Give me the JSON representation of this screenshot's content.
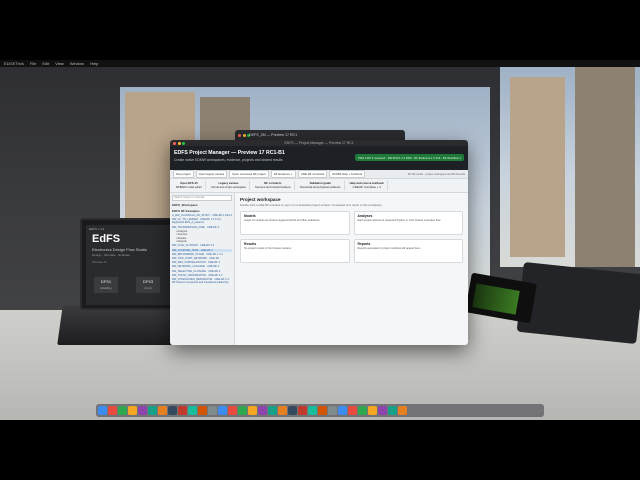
{
  "menubar": {
    "items": [
      "EDGETrick",
      "File",
      "Edit",
      "View",
      "Window",
      "Help"
    ]
  },
  "back_window": {
    "title": "DEFS_2M — Preview 17 RC1"
  },
  "window": {
    "titlebar_title": "EDFS — Project Manager — Preview 17 RC1",
    "header_title": "EDFS Project Manager — Preview 17 RC1-B1",
    "header_subtitle": "Create native EDMW workspaces, evidence, projects and shared results",
    "header_badge": "PRE 4 RF 9 reviewed · DW RCF1 2 4 RRS · RF Evidence 1 0 Full · RF Workflow 1",
    "toolbar": {
      "buttons": [
        "New project",
        "Open legacy canvas",
        "Open recovered RF project",
        "RF Evidence ✓",
        "CRE-RF Contracts",
        "RCMW Help + Textbook"
      ],
      "status": "RF 99 results · project workspace and RF Results"
    },
    "ribbon": [
      {
        "title": "Open EFS-15",
        "sub": "RFBAM model editor"
      },
      {
        "title": "Legacy canvas",
        "sub": "Circuit and script workspace"
      },
      {
        "title": "RF contracts",
        "sub": "Sources and transformations"
      },
      {
        "title": "Validation guide",
        "sub": "Numerical and physical evidence"
      },
      {
        "title": "Help and course textbook",
        "sub": "CRE-RF Complete + 4"
      }
    ],
    "sidebar": {
      "search_placeholder": "Search project or example",
      "groups": [
        {
          "label": "EDFS_Workspace",
          "items": []
        },
        {
          "label": "EDFS RF Examples",
          "items": [
            "A_RW_CLASSICAL_PA_STUDY · CRE-RF 1 Part 2",
            "RW_LC_TN_LADDER · CRE-RF 1 4 4 C4 · Supported EOS_d_patterns",
            "RW_TRANSMISSION_LINE · CRE-RF 3",
            "RW_LCAV_AUTOTAP · CRE-RF 3 5",
            "RW_COUPLED_TANK · CRE-RF 3",
            "RW_BROADBAND_PLANE · CRE-RF 1 4 4",
            "RW_TWO_PORT_NETWORK · CRE-RF",
            "RW_RES_NORMALIZATION · CRE-RF 3",
            "RW_NETWORK_CASCADE · CRE-RF 4",
            "RW_SELECTIVE_CLOSURE · CRE-RF 4",
            "RW_STATIC_INFORMATION · CRE-RF 3 4",
            "RW_ATTENUATED_RESONATOR · CRE-RF 2 4 · RF channel compound and impedance balancing"
          ]
        }
      ],
      "selected_index": 4,
      "subitems": [
        "Analysis",
        "Sources",
        "Results",
        "Reports"
      ]
    },
    "main": {
      "title": "Project workspace",
      "subtitle": "Double-click a CRE-RF example to open it in a dedicated project window. Completed runs return to this workspace.",
      "cards": [
        {
          "title": "Models",
          "desc": "Graph v3 models use shared registered block and fiber definitions."
        },
        {
          "title": "Analyses",
          "desc": "Each project selects its requested Python or Octo Octave execution flow."
        },
        {
          "title": "Results",
          "desc": "No project results in this browser session."
        },
        {
          "title": "Reports",
          "desc": "Reports generated in project windows will appear here."
        }
      ]
    }
  },
  "laptop": {
    "header": "EDFS v.4.3",
    "app_name": "EdFS",
    "tagline": "Electronics Design Flow Studio",
    "sub": "Design · Simulate · Evaluate",
    "version": "Preview 17",
    "tile1": "DFS1",
    "tile1_label": "Modelling",
    "tile2": "DFS3",
    "tile2_label": "Circuit"
  },
  "dock": {
    "icons": [
      "finder",
      "launchpad",
      "safari",
      "messages",
      "mail",
      "maps",
      "photos",
      "facetime",
      "calendar",
      "contacts",
      "reminders",
      "notes",
      "music",
      "podcasts",
      "tv",
      "news",
      "app-store",
      "settings",
      "terminal",
      "vscode",
      "ki",
      "word",
      "excel",
      "powerpoint",
      "chrome",
      "firefox",
      "slack",
      "zoom",
      "teams",
      "edfs",
      "trash"
    ]
  }
}
